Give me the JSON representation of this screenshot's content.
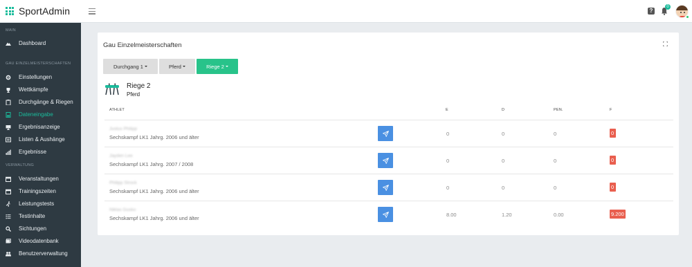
{
  "app": {
    "title": "SportAdmin"
  },
  "header": {
    "notification_count": "0"
  },
  "sidebar": {
    "sections": [
      {
        "label": "MAIN"
      },
      {
        "label": "GAU EINZELMEISTERSCHAFTEN"
      },
      {
        "label": "VERWALTUNG"
      }
    ],
    "items": [
      {
        "label": "Dashboard",
        "icon": "mountain-icon"
      },
      {
        "label": "Einstellungen",
        "icon": "gear-icon"
      },
      {
        "label": "Wettkämpfe",
        "icon": "trophy-icon"
      },
      {
        "label": "Durchgänge & Riegen",
        "icon": "clipboard-icon"
      },
      {
        "label": "Dateneingabe",
        "icon": "data-entry-icon",
        "active": true
      },
      {
        "label": "Ergebnisanzeige",
        "icon": "monitor-icon"
      },
      {
        "label": "Listen & Aushänge",
        "icon": "list-icon"
      },
      {
        "label": "Ergebnisse",
        "icon": "bar-chart-icon"
      },
      {
        "label": "Veranstaltungen",
        "icon": "calendar-icon"
      },
      {
        "label": "Trainingszeiten",
        "icon": "calendar-icon"
      },
      {
        "label": "Leistungstests",
        "icon": "runner-icon"
      },
      {
        "label": "Testinhalte",
        "icon": "list-icon"
      },
      {
        "label": "Sichtungen",
        "icon": "search-icon"
      },
      {
        "label": "Videodatenbank",
        "icon": "video-icon"
      },
      {
        "label": "Benutzerverwaltung",
        "icon": "users-icon"
      }
    ]
  },
  "main": {
    "title": "Gau Einzelmeisterschaften",
    "filters": [
      {
        "label": "Durchgang 1"
      },
      {
        "label": "Pferd"
      },
      {
        "label": "Riege 2"
      }
    ],
    "riege": {
      "title": "Riege 2",
      "apparatus": "Pferd"
    },
    "table": {
      "headers": {
        "athlet": "ATHLET",
        "e": "E",
        "d": "D",
        "pen": "PEN.",
        "f": "F"
      },
      "rows": [
        {
          "name": "Justus Philipp",
          "category": "Sechskampf LK1 Jahrg. 2006 und älter",
          "e": "0",
          "d": "0",
          "pen": "0",
          "f": "0"
        },
        {
          "name": "Jayden Lee",
          "category": "Sechskampf LK1 Jahrg. 2007 / 2008",
          "e": "0",
          "d": "0",
          "pen": "0",
          "f": "0"
        },
        {
          "name": "Philipp Strock",
          "category": "Sechskampf LK1 Jahrg. 2006 und älter",
          "e": "0",
          "d": "0",
          "pen": "0",
          "f": "0"
        },
        {
          "name": "Niklas Gusko",
          "category": "Sechskampf LK1 Jahrg. 2006 und älter",
          "e": "8.00",
          "d": "1.20",
          "pen": "0.00",
          "f": "9.200"
        }
      ]
    }
  },
  "colors": {
    "accent": "#1abc9c",
    "sidebar": "#2e3a42",
    "primary_button": "#4a90e2",
    "score_badge": "#e95f4f"
  }
}
